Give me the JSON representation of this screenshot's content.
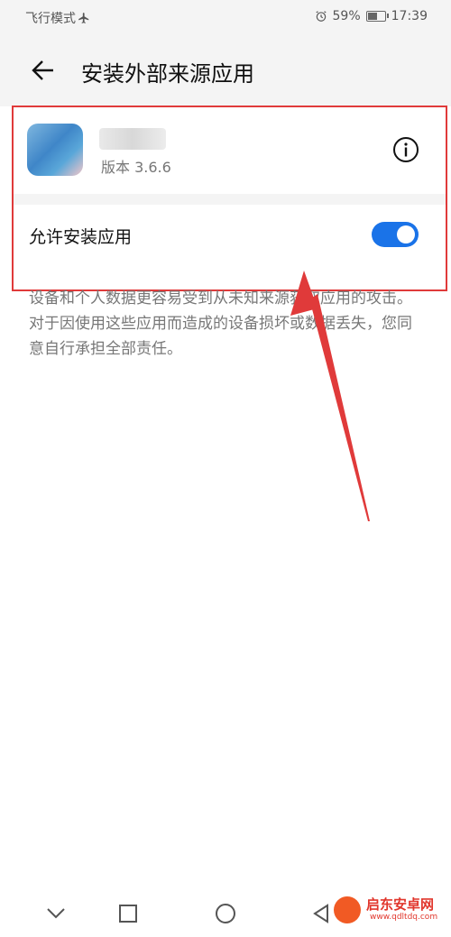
{
  "status_bar": {
    "mode": "飞行模式",
    "battery": "59%",
    "battery_level": 0.59,
    "time": "17:39"
  },
  "header": {
    "title": "安装外部来源应用"
  },
  "app": {
    "version": "版本 3.6.6"
  },
  "setting": {
    "label": "允许安装应用",
    "enabled": true
  },
  "warning": "设备和个人数据更容易受到从未知来源获取应用的攻击。对于因使用这些应用而造成的设备损坏或数据丢失，您同意自行承担全部责任。",
  "colors": {
    "accent": "#1a73e8",
    "highlight": "#e03a3a"
  },
  "watermark": {
    "name": "启东安卓网",
    "url": "www.qdltdq.com"
  }
}
